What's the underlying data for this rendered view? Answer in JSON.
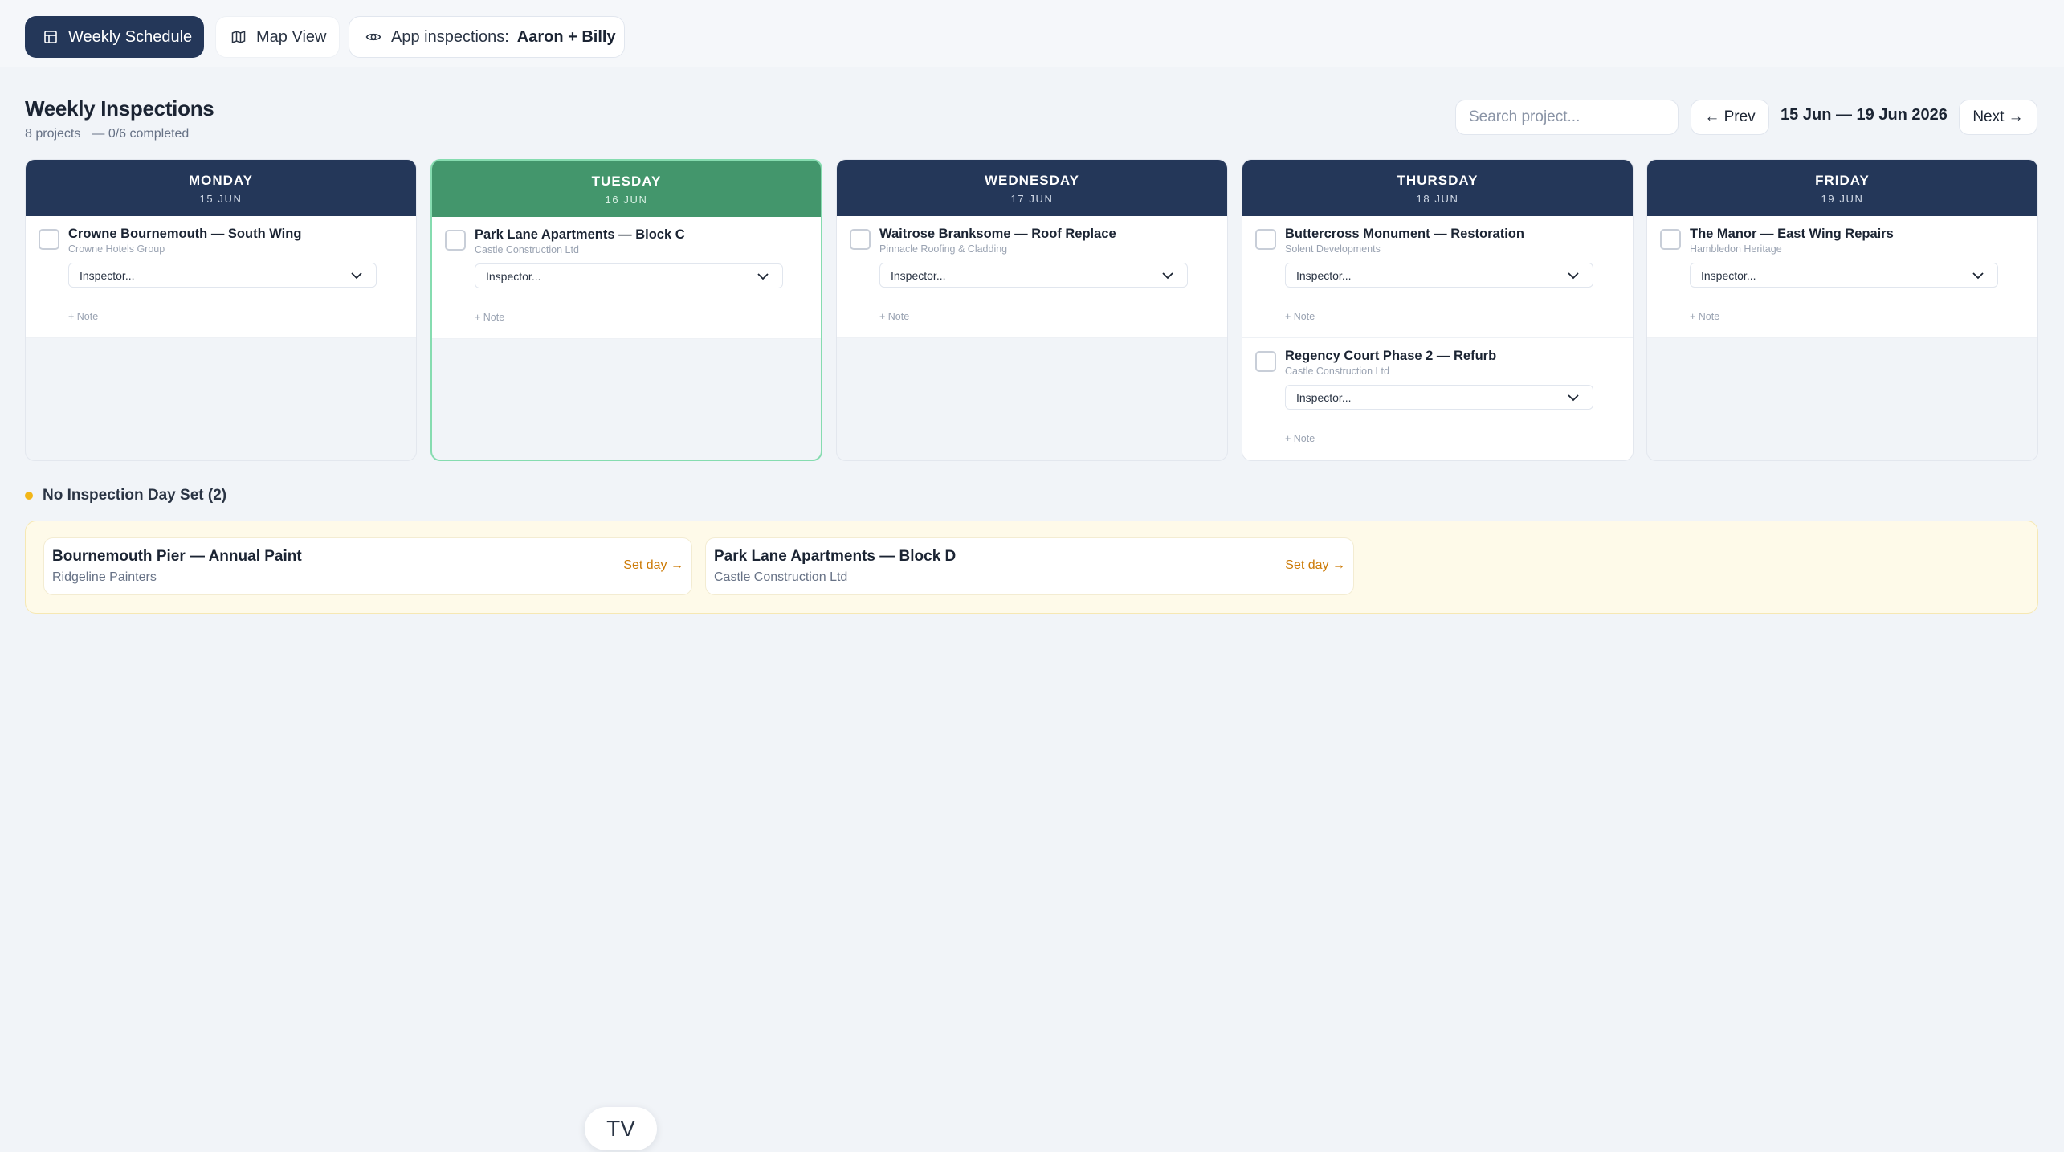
{
  "tabs": {
    "weekly": {
      "label": "Weekly Schedule",
      "icon": "table-icon"
    },
    "map": {
      "label": "Map View",
      "icon": "map-icon"
    },
    "app": {
      "label": "App inspections:",
      "value": "Aaron + Billy",
      "icon": "eye-icon"
    }
  },
  "header": {
    "title": "Weekly Inspections",
    "projects": "8 projects",
    "completed": "— 0/6 completed",
    "search_placeholder": "Search project...",
    "prev_label": "← Prev",
    "next_label": "Next →",
    "range": "15 Jun — 19 Jun 2026"
  },
  "days": [
    {
      "name": "MONDAY",
      "date": "15 JUN",
      "today": false,
      "projects": [
        {
          "name": "Crowne Bournemouth — South Wing",
          "client": "Crowne Hotels Group",
          "inspector": "Inspector...",
          "note": "+ Note"
        }
      ]
    },
    {
      "name": "TUESDAY",
      "date": "16 JUN",
      "today": true,
      "projects": [
        {
          "name": "Park Lane Apartments — Block C",
          "client": "Castle Construction Ltd",
          "inspector": "Inspector...",
          "note": "+ Note"
        }
      ]
    },
    {
      "name": "WEDNESDAY",
      "date": "17 JUN",
      "today": false,
      "projects": [
        {
          "name": "Waitrose Branksome — Roof Replace",
          "client": "Pinnacle Roofing & Cladding",
          "inspector": "Inspector...",
          "note": "+ Note"
        }
      ]
    },
    {
      "name": "THURSDAY",
      "date": "18 JUN",
      "today": false,
      "projects": [
        {
          "name": "Buttercross Monument — Restoration",
          "client": "Solent Developments",
          "inspector": "Inspector...",
          "note": "+ Note"
        },
        {
          "name": "Regency Court Phase 2 — Refurb",
          "client": "Castle Construction Ltd",
          "inspector": "Inspector...",
          "note": "+ Note"
        }
      ]
    },
    {
      "name": "FRIDAY",
      "date": "19 JUN",
      "today": false,
      "projects": [
        {
          "name": "The Manor — East Wing Repairs",
          "client": "Hambledon Heritage",
          "inspector": "Inspector...",
          "note": "+ Note"
        }
      ]
    }
  ],
  "unassigned": {
    "title": "No Inspection Day Set (2)",
    "items": [
      {
        "name": "Bournemouth Pier — Annual Paint",
        "client": "Ridgeline Painters",
        "action": "Set day →"
      },
      {
        "name": "Park Lane Apartments — Block D",
        "client": "Castle Construction Ltd",
        "action": "Set day →"
      }
    ]
  },
  "tv_label": "TV",
  "colors": {
    "navy": "#243759",
    "today_green": "#43966c",
    "unset_dot": "#f2b619",
    "set_day": "#cc7a06"
  }
}
